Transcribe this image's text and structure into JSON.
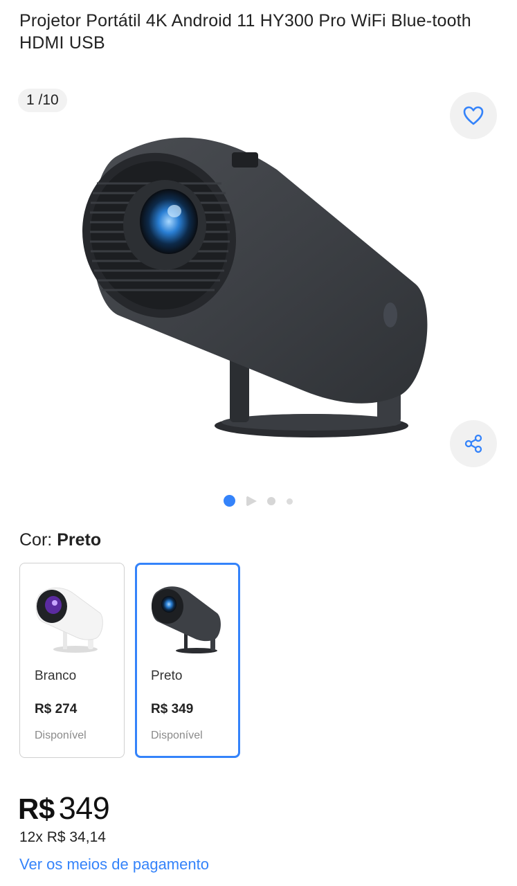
{
  "product": {
    "title": "Projetor Portátil 4K Android 11 HY300 Pro WiFi Blue-tooth HDMI USB"
  },
  "gallery": {
    "counter": "1 /10",
    "favorite_icon": "heart-icon",
    "share_icon": "share-icon",
    "current_index": 1,
    "total": 10
  },
  "color": {
    "label": "Cor:",
    "selected": "Preto"
  },
  "variants": [
    {
      "name": "Branco",
      "price": "R$ 274",
      "status": "Disponível",
      "selected": false
    },
    {
      "name": "Preto",
      "price": "R$ 349",
      "status": "Disponível",
      "selected": true
    }
  ],
  "price": {
    "currency": "R$",
    "amount": "349",
    "installments": "12x R$ 34,14"
  },
  "payment_link": "Ver os meios de pagamento",
  "colors": {
    "accent": "#3483fa",
    "text": "#222222",
    "muted": "#8a8a8a"
  }
}
